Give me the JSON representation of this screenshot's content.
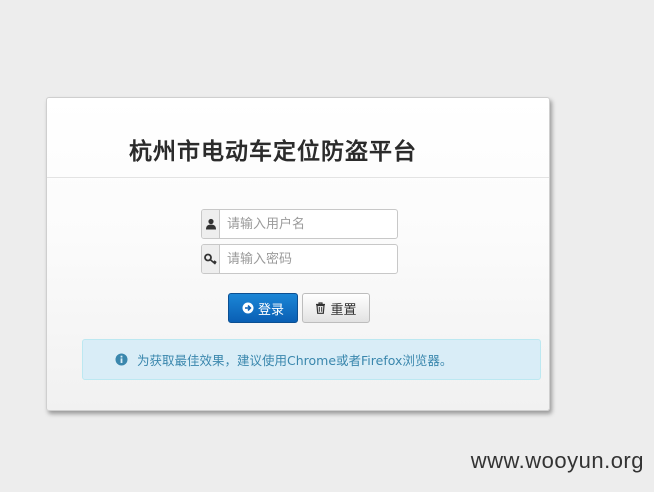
{
  "login": {
    "title": "杭州市电动车定位防盗平台",
    "username_placeholder": "请输入用户名",
    "password_placeholder": "请输入密码",
    "login_button": "登录",
    "reset_button": "重置",
    "info_text": "为获取最佳效果，建议使用Chrome或者Firefox浏览器。"
  },
  "watermark": "www.wooyun.org",
  "icons": {
    "user": "user-icon",
    "key": "key-icon",
    "login": "arrow-circle-right-icon",
    "reset": "trash-icon",
    "info": "info-icon"
  },
  "colors": {
    "primary_button": "#0a5fb4",
    "info_background": "#d9edf7",
    "info_text": "#3a87ad"
  }
}
